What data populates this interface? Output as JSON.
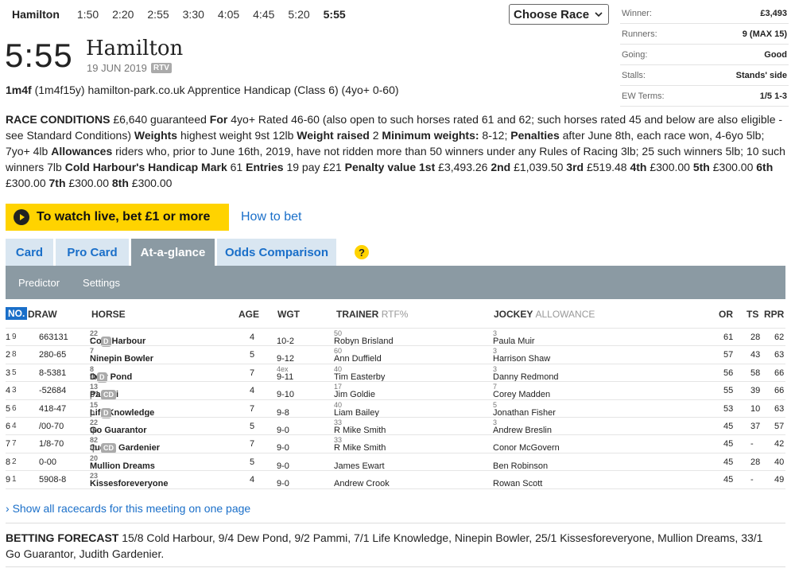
{
  "timebar": {
    "course": "Hamilton",
    "times": [
      "1:50",
      "2:20",
      "2:55",
      "3:30",
      "4:05",
      "4:45",
      "5:20",
      "5:55"
    ],
    "active": "5:55",
    "choose_label": "Choose Race"
  },
  "header": {
    "time": "5:55",
    "course": "Hamilton",
    "date": "19 JUN 2019",
    "rtv": "RTV",
    "distance": "1m4f",
    "details": "(1m4f15y) hamilton-park.co.uk Apprentice Handicap (Class 6) (4yo+ 0-60)"
  },
  "info": [
    {
      "label": "Winner:",
      "value": "£3,493"
    },
    {
      "label": "Runners:",
      "value": "9 (MAX 15)"
    },
    {
      "label": "Going:",
      "value": "Good"
    },
    {
      "label": "Stalls:",
      "value": "Stands' side"
    },
    {
      "label": "EW Terms:",
      "value": "1/5 1-3"
    }
  ],
  "conditions": [
    {
      "b": true,
      "t": "RACE CONDITIONS"
    },
    {
      "b": false,
      "t": " £6,640 guaranteed "
    },
    {
      "b": true,
      "t": "For"
    },
    {
      "b": false,
      "t": " 4yo+ Rated 46-60 (also open to such horses rated 61 and 62; such horses rated 45 and below are also eligible - see Standard Conditions) "
    },
    {
      "b": true,
      "t": "Weights"
    },
    {
      "b": false,
      "t": " highest weight 9st 12lb "
    },
    {
      "b": true,
      "t": "Weight raised"
    },
    {
      "b": false,
      "t": " 2 "
    },
    {
      "b": true,
      "t": "Minimum weights:"
    },
    {
      "b": false,
      "t": " 8-12; "
    },
    {
      "b": true,
      "t": "Penalties"
    },
    {
      "b": false,
      "t": " after June 8th, each race won, 4-6yo 5lb; 7yo+ 4lb "
    },
    {
      "b": true,
      "t": "Allowances"
    },
    {
      "b": false,
      "t": " riders who, prior to June 16th, 2019, have not ridden more than 50 winners under any Rules of Racing 3lb; 25 such winners 5lb; 10 such winners 7lb "
    },
    {
      "b": true,
      "t": "Cold Harbour's Handicap Mark"
    },
    {
      "b": false,
      "t": " 61 "
    },
    {
      "b": true,
      "t": "Entries"
    },
    {
      "b": false,
      "t": " 19 pay £21 "
    },
    {
      "b": true,
      "t": "Penalty value 1st"
    },
    {
      "b": false,
      "t": " £3,493.26 "
    },
    {
      "b": true,
      "t": "2nd"
    },
    {
      "b": false,
      "t": " £1,039.50 "
    },
    {
      "b": true,
      "t": "3rd"
    },
    {
      "b": false,
      "t": " £519.48 "
    },
    {
      "b": true,
      "t": "4th"
    },
    {
      "b": false,
      "t": " £300.00 "
    },
    {
      "b": true,
      "t": "5th"
    },
    {
      "b": false,
      "t": " £300.00 "
    },
    {
      "b": true,
      "t": "6th"
    },
    {
      "b": false,
      "t": " £300.00 "
    },
    {
      "b": true,
      "t": "7th"
    },
    {
      "b": false,
      "t": " £300.00 "
    },
    {
      "b": true,
      "t": "8th"
    },
    {
      "b": false,
      "t": " £300.00"
    }
  ],
  "watch": {
    "label": "To watch live, bet £1 or more",
    "howto": "How to bet"
  },
  "tabs": [
    "Card",
    "Pro Card",
    "At-a-glance",
    "Odds Comparison"
  ],
  "active_tab": "At-a-glance",
  "help": "?",
  "subtabs": [
    "Predictor",
    "Settings"
  ],
  "table": {
    "headers": {
      "no": "NO.",
      "draw": "DRAW",
      "horse": "HORSE",
      "age": "AGE",
      "wgt": "WGT",
      "trainer": "TRAINER",
      "trainer_sub": "RTF%",
      "jockey": "JOCKEY",
      "jockey_sub": "ALLOWANCE",
      "or": "OR",
      "ts": "TS",
      "rpr": "RPR"
    },
    "rows": [
      {
        "no": "1",
        "draw": "9",
        "form": "663131",
        "horse": "Cold Harbour",
        "gear": "t",
        "days": "22",
        "badge": "D",
        "age": "4",
        "wgt": "10-2",
        "wgt_sup": "",
        "trainer": "Robyn Brisland",
        "rtf": "50",
        "jockey": "Paula Muir",
        "allow": "3",
        "or": "61",
        "ts": "28",
        "rpr": "62"
      },
      {
        "no": "2",
        "draw": "8",
        "form": "280-65",
        "horse": "Ninepin Bowler",
        "gear": "",
        "days": "7",
        "badge": "",
        "age": "5",
        "wgt": "9-12",
        "wgt_sup": "",
        "trainer": "Ann Duffield",
        "rtf": "60",
        "jockey": "Harrison Shaw",
        "allow": "3",
        "or": "57",
        "ts": "43",
        "rpr": "63"
      },
      {
        "no": "3",
        "draw": "5",
        "form": "8-5381",
        "horse": "Dew Pond",
        "gear": "tb",
        "days": "8",
        "badge": "D",
        "age": "7",
        "wgt": "9-11",
        "wgt_sup": "4ex",
        "trainer": "Tim Easterby",
        "rtf": "40",
        "jockey": "Danny Redmond",
        "allow": "3",
        "or": "56",
        "ts": "58",
        "rpr": "66"
      },
      {
        "no": "4",
        "draw": "3",
        "form": "-52684",
        "horse": "Pammi",
        "gear": "p1",
        "days": "13",
        "badge": "CD",
        "age": "4",
        "wgt": "9-10",
        "wgt_sup": "",
        "trainer": "Jim Goldie",
        "rtf": "17",
        "jockey": "Corey Madden",
        "allow": "7",
        "or": "55",
        "ts": "39",
        "rpr": "66"
      },
      {
        "no": "5",
        "draw": "6",
        "form": "418-47",
        "horse": "Life Knowledge",
        "gear": "p",
        "days": "15",
        "badge": "D",
        "age": "7",
        "wgt": "9-8",
        "wgt_sup": "",
        "trainer": "Liam Bailey",
        "rtf": "40",
        "jockey": "Jonathan Fisher",
        "allow": "5",
        "or": "53",
        "ts": "10",
        "rpr": "63"
      },
      {
        "no": "6",
        "draw": "4",
        "form": "/00-70",
        "horse": "Go Guarantor",
        "gear": "tp",
        "days": "22",
        "badge": "",
        "age": "5",
        "wgt": "9-0",
        "wgt_sup": "",
        "trainer": "R Mike Smith",
        "rtf": "33",
        "jockey": "Andrew Breslin",
        "allow": "3",
        "or": "45",
        "ts": "37",
        "rpr": "57"
      },
      {
        "no": "7",
        "draw": "7",
        "form": "1/8-70",
        "horse": "Judith Gardenier",
        "gear": "tp",
        "days": "82",
        "badge": "CD",
        "age": "7",
        "wgt": "9-0",
        "wgt_sup": "",
        "trainer": "R Mike Smith",
        "rtf": "33",
        "jockey": "Conor McGovern",
        "allow": "",
        "or": "45",
        "ts": "-",
        "rpr": "42"
      },
      {
        "no": "8",
        "draw": "2",
        "form": "0-00",
        "horse": "Mullion Dreams",
        "gear": "",
        "days": "20",
        "badge": "",
        "age": "5",
        "wgt": "9-0",
        "wgt_sup": "",
        "trainer": "James Ewart",
        "rtf": "",
        "jockey": "Ben Robinson",
        "allow": "",
        "or": "45",
        "ts": "28",
        "rpr": "40"
      },
      {
        "no": "9",
        "draw": "1",
        "form": "5908-8",
        "horse": "Kissesforeveryone",
        "gear": "",
        "days": "23",
        "badge": "",
        "age": "4",
        "wgt": "9-0",
        "wgt_sup": "",
        "trainer": "Andrew Crook",
        "rtf": "",
        "jockey": "Rowan Scott",
        "allow": "",
        "or": "45",
        "ts": "-",
        "rpr": "49"
      }
    ]
  },
  "show_all": "Show all racecards for this meeting on one page",
  "forecast": {
    "label": "BETTING FORECAST",
    "text": " 15/8 Cold Harbour, 9/4 Dew Pond, 9/2 Pammi, 7/1 Life Knowledge, Ninepin Bowler, 25/1 Kissesforeveryone, Mullion Dreams, 33/1 Go Guarantor, Judith Gardenier."
  },
  "colors": {
    "accent": "#1a6fc9",
    "banner": "#ffd300",
    "tab_active": "#8b9aa3",
    "tab": "#d9e6f1"
  }
}
